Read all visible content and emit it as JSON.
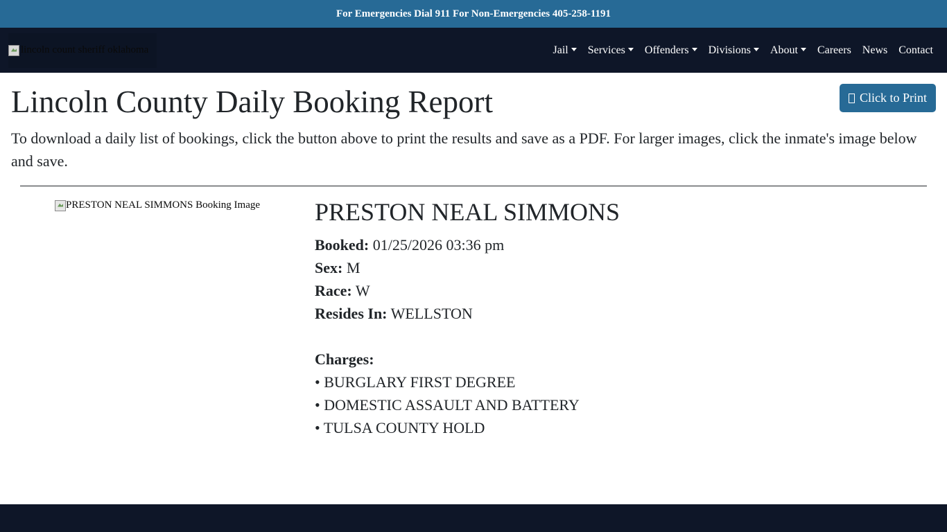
{
  "topbar": {
    "text": "For Emergencies Dial 911 For Non-Emergencies 405-258-1191"
  },
  "header": {
    "logo_alt": "lincoln count sheriff oklahoma",
    "nav": [
      {
        "label": "Jail",
        "dropdown": true
      },
      {
        "label": "Services",
        "dropdown": true
      },
      {
        "label": "Offenders",
        "dropdown": true
      },
      {
        "label": "Divisions",
        "dropdown": true
      },
      {
        "label": "About",
        "dropdown": true
      },
      {
        "label": "Careers",
        "dropdown": false
      },
      {
        "label": "News",
        "dropdown": false
      },
      {
        "label": "Contact",
        "dropdown": false
      }
    ]
  },
  "main": {
    "title": "Lincoln County Daily Booking Report",
    "print_button": "Click to Print",
    "intro": "To download a daily list of bookings, click the button above to print the results and save as a PDF. For larger images, click the inmate's image below and save."
  },
  "inmate": {
    "image_alt": "PRESTON NEAL SIMMONS Booking Image",
    "name": "PRESTON NEAL SIMMONS",
    "booked_label": "Booked:",
    "booked": "01/25/2026 03:36 pm",
    "sex_label": "Sex:",
    "sex": "M",
    "race_label": "Race:",
    "race": "W",
    "resides_label": "Resides In:",
    "resides": "WELLSTON",
    "charges_label": "Charges:",
    "charges": [
      "• BURGLARY FIRST DEGREE",
      "• DOMESTIC ASSAULT AND BATTERY",
      "• TULSA COUNTY HOLD"
    ]
  },
  "colors": {
    "brand_blue": "#276a96",
    "navy": "#0e1628"
  }
}
